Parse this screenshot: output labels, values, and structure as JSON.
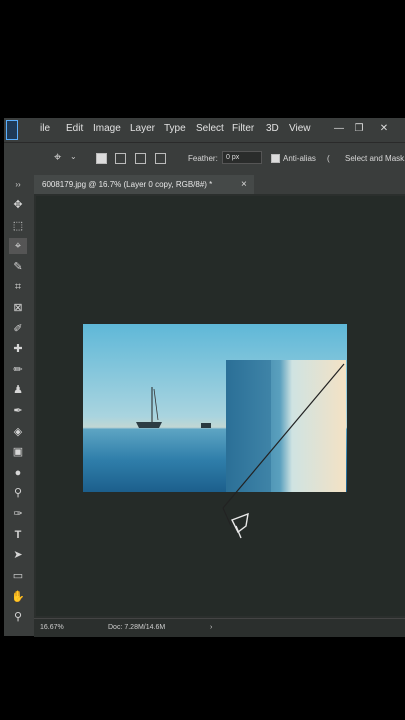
{
  "menu": [
    "ile",
    "Edit",
    "Image",
    "Layer",
    "Type",
    "Select",
    "Filter",
    "3D",
    "View"
  ],
  "window_buttons": [
    "—",
    "❐",
    "✕"
  ],
  "options": {
    "feather_label": "Feather:",
    "feather_value": "0 px",
    "antialias_label": "Anti-alias",
    "select_mask_label": "Select and Mask..."
  },
  "tab": {
    "title": "6008179.jpg @ 16.7% (Layer 0 copy, RGB/8#) *",
    "close": "×"
  },
  "status": {
    "zoom": "16.67%",
    "doc": "Doc: 7.28M/14.6M",
    "arrow": "›"
  },
  "tools": [
    "move-tool",
    "marquee-tool",
    "polygonal-lasso-tool",
    "magic-wand-tool",
    "crop-tool",
    "frame-tool",
    "eyedropper-tool",
    "healing-brush-tool",
    "brush-tool",
    "clone-stamp-tool",
    "history-brush-tool",
    "eraser-tool",
    "gradient-tool",
    "blur-tool",
    "dodge-tool",
    "pen-tool",
    "type-tool",
    "path-selection-tool",
    "rectangle-tool",
    "hand-tool",
    "zoom-tool"
  ]
}
